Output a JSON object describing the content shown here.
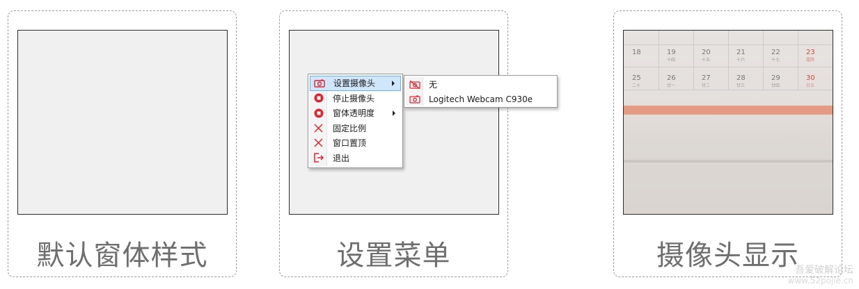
{
  "panels": [
    {
      "caption": "默认窗体样式"
    },
    {
      "caption": "设置菜单"
    },
    {
      "caption": "摄像头显示"
    }
  ],
  "menu": {
    "items": [
      {
        "label": "设置摄像头",
        "icon": "camera-icon",
        "has_submenu": true,
        "highlighted": true
      },
      {
        "label": "停止摄像头",
        "icon": "stop-icon",
        "has_submenu": false
      },
      {
        "label": "窗体透明度",
        "icon": "stop-icon",
        "has_submenu": true
      },
      {
        "label": "固定比例",
        "icon": "x-icon",
        "has_submenu": false
      },
      {
        "label": "窗口置顶",
        "icon": "x-icon",
        "has_submenu": false
      },
      {
        "label": "退出",
        "icon": "exit-icon",
        "has_submenu": false
      }
    ]
  },
  "submenu": {
    "items": [
      {
        "label": "无",
        "icon": "camera-off-icon"
      },
      {
        "label": "Logitech Webcam C930e",
        "icon": "camera-icon"
      }
    ]
  },
  "calendar": {
    "row1": [
      {
        "num": "18",
        "sub": ""
      },
      {
        "num": "19",
        "sub": "十四"
      },
      {
        "num": "20",
        "sub": "十五"
      },
      {
        "num": "21",
        "sub": "十六"
      },
      {
        "num": "22",
        "sub": "十七"
      },
      {
        "num": "23",
        "sub": "霜降"
      }
    ],
    "row2": [
      {
        "num": "25",
        "sub": "二十"
      },
      {
        "num": "26",
        "sub": "廿一"
      },
      {
        "num": "27",
        "sub": "廿二"
      },
      {
        "num": "28",
        "sub": "廿三"
      },
      {
        "num": "29",
        "sub": "廿四"
      },
      {
        "num": "30",
        "sub": "廿五"
      }
    ]
  },
  "watermark": {
    "line1": "吾爱破解论坛",
    "line2": "www.52pojie.cn"
  },
  "colors": {
    "accent_red": "#e0242e",
    "highlight": "#cfe6fb",
    "highlight_border": "#6cb1ec"
  }
}
